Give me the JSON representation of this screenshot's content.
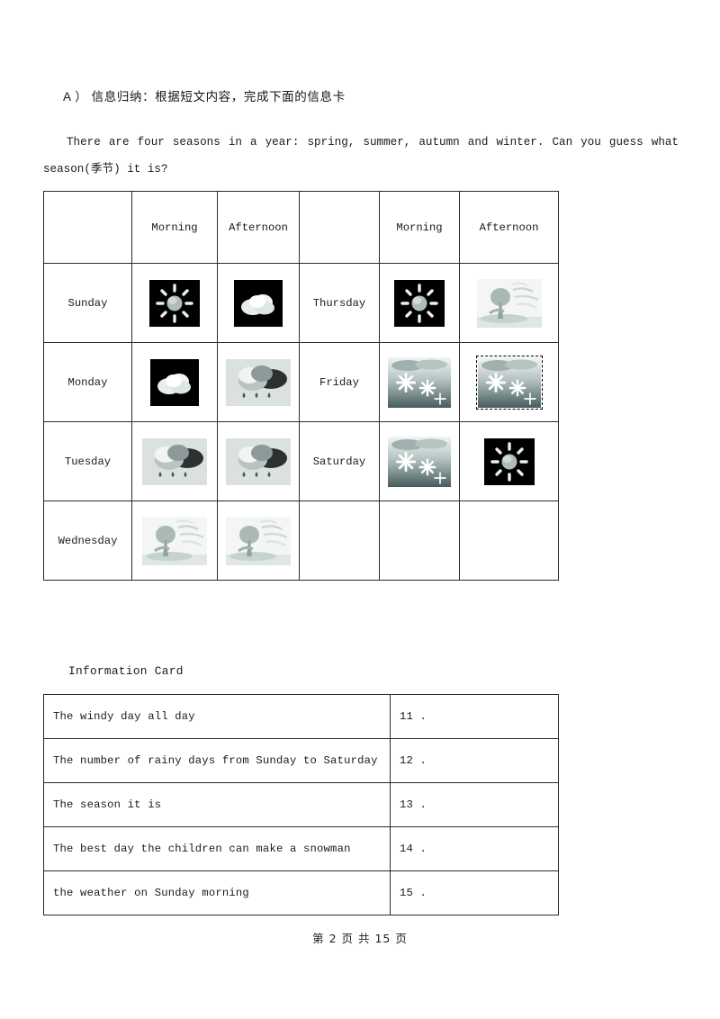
{
  "document": {
    "prompt_label": "A ）",
    "prompt_text": "信息归纳：根据短文内容，完成下面的信息卡",
    "paragraph_line1": "There are four seasons in a year: spring, summer, autumn and winter. Can you guess what",
    "paragraph_line2": "season(季节) it is?",
    "info_card_title": "Information Card",
    "footer": "第 2 页 共 15 页"
  },
  "weather_table": {
    "headers": {
      "col1": "",
      "col2": "Morning",
      "col3": "Afternoon",
      "col4": "",
      "col5": "Morning",
      "col6": "Afternoon"
    },
    "rows": [
      {
        "day_left": "Sunday",
        "left_morning_icon": "sun-icon",
        "left_afternoon_icon": "cloud-icon",
        "day_right": "Thursday",
        "right_morning_icon": "sun-icon",
        "right_afternoon_icon": "windy-icon"
      },
      {
        "day_left": "Monday",
        "left_morning_icon": "cloud-icon",
        "left_afternoon_icon": "rain-icon",
        "day_right": "Friday",
        "right_morning_icon": "snow-icon",
        "right_afternoon_icon": "snow-icon-selected"
      },
      {
        "day_left": "Tuesday",
        "left_morning_icon": "rain-icon",
        "left_afternoon_icon": "rain-icon",
        "day_right": "Saturday",
        "right_morning_icon": "snow-icon",
        "right_afternoon_icon": "sun-icon"
      },
      {
        "day_left": "Wednesday",
        "left_morning_icon": "windy-icon",
        "left_afternoon_icon": "windy-icon",
        "day_right": "",
        "right_morning_icon": "",
        "right_afternoon_icon": ""
      }
    ]
  },
  "info_card": {
    "rows": [
      {
        "label": "The windy day all day",
        "answer": "11 ."
      },
      {
        "label": "The number of rainy days from Sunday to Saturday",
        "answer": "12 ."
      },
      {
        "label": "The season it is",
        "answer": "13 ."
      },
      {
        "label": "The best day the children can make a snowman",
        "answer": "14 ."
      },
      {
        "label": "the weather on Sunday morning",
        "answer": "15 ."
      }
    ]
  },
  "colors": {
    "page_background": "#ffffff",
    "text": "#1a1a1a",
    "table_border": "#2b2b2b",
    "icon_dark_background": "#000000"
  }
}
